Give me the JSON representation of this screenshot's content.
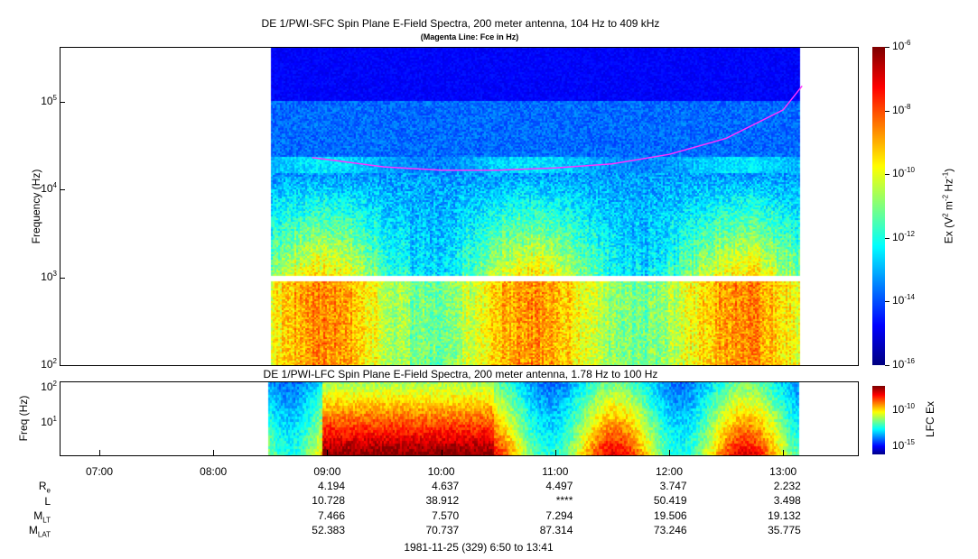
{
  "chart_data": [
    {
      "type": "heatmap",
      "title": "DE 1/PWI-SFC  Spin Plane E-Field Spectra, 200 meter antenna, 104 Hz to 409 kHz",
      "subtitle": "(Magenta Line: Fce in Hz)",
      "ylabel": "Frequency (Hz)",
      "yscale": "log",
      "ylim": [
        100,
        409000
      ],
      "yticks": [
        "10^2",
        "10^3",
        "10^4",
        "10^5"
      ],
      "colorbar": {
        "label": "Ex (V^2 m^-2 Hz^-1)",
        "range": [
          1e-16,
          1e-06
        ],
        "ticks": [
          "10^-6",
          "10^-8",
          "10^-10",
          "10^-12",
          "10^-14",
          "10^-16"
        ]
      },
      "fce_line": {
        "color": "#ff33ff",
        "x": [
          "08:52",
          "09:30",
          "10:00",
          "10:30",
          "11:00",
          "11:30",
          "12:00",
          "12:30",
          "13:00",
          "13:10"
        ],
        "y": [
          23000,
          18000,
          16500,
          16500,
          17500,
          19500,
          25000,
          38000,
          80000,
          150000
        ]
      },
      "data_time_range": [
        "08:50",
        "13:10"
      ]
    },
    {
      "type": "heatmap",
      "title": "DE 1/PWI-LFC  Spin Plane E-Field Spectra, 200 meter antenna, 1.78 Hz to 100 Hz",
      "ylabel": "Freq (Hz)",
      "yscale": "log",
      "ylim": [
        1.78,
        100
      ],
      "yticks": [
        "10^1",
        "10^2"
      ],
      "colorbar": {
        "label": "LFC Ex",
        "ticks": [
          "10^-10",
          "10^-15"
        ]
      },
      "data_time_range": [
        "08:50",
        "13:10"
      ]
    }
  ],
  "xaxis": {
    "ticks": [
      "07:00",
      "08:00",
      "09:00",
      "10:00",
      "11:00",
      "12:00",
      "13:00"
    ]
  },
  "ephemeris": {
    "labels": {
      "re": "R",
      "re_sub": "e",
      "l": "L",
      "mlt": "M",
      "mlt_sub": "LT",
      "mlat": "M",
      "mlat_sub": "LAT"
    },
    "rows": {
      "re": [
        "4.194",
        "4.637",
        "4.497",
        "3.747",
        "2.232"
      ],
      "l": [
        "10.728",
        "38.912",
        "****",
        "50.419",
        "3.498"
      ],
      "mlt": [
        "7.466",
        "7.570",
        "7.294",
        "19.506",
        "19.132"
      ],
      "mlat": [
        "52.383",
        "70.737",
        "87.314",
        "73.246",
        "35.775"
      ]
    }
  },
  "footer": "1981-11-25 (329) 6:50 to 13:41"
}
